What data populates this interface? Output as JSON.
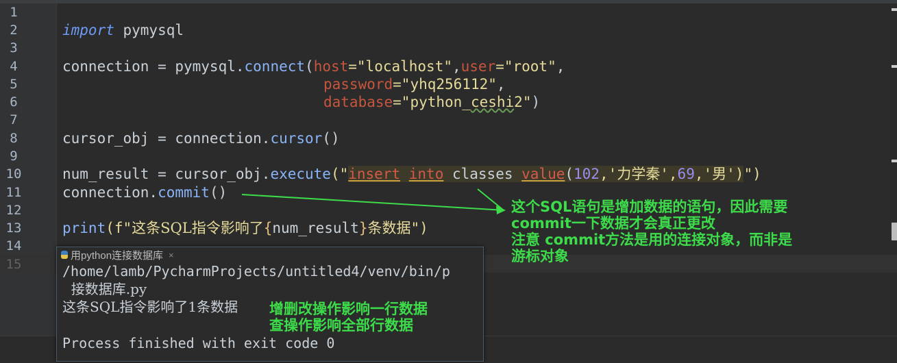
{
  "line_numbers": [
    "1",
    "2",
    "3",
    "4",
    "5",
    "6",
    "7",
    "8",
    "9",
    "10",
    "11",
    "12",
    "13",
    "14",
    "15"
  ],
  "code": {
    "l2_kw": "import",
    "l2_rest": " pymysql",
    "l4_a": "connection = pymysql.",
    "l4_fn": "connect",
    "l4_b": "(",
    "l4_p1": "host",
    "l4_s1": "=\"localhost\"",
    "l4_c": ",",
    "l4_p2": "user",
    "l4_s2": "=\"root\"",
    "l4_d": ",",
    "l5_p": "password",
    "l5_s": "=\"yhq256112\"",
    "l5_c": ",",
    "l6_p": "database",
    "l6_s1": "=\"python_",
    "l6_sq": "ceshi",
    "l6_s2": "2\"",
    "l6_e": ")",
    "l8_a": "cursor_obj = connection.",
    "l8_fn": "cursor",
    "l8_b": "()",
    "l10_a": "num_result = cursor_obj.",
    "l10_fn": "execute",
    "l10_b": "(\"",
    "l10_k1": "insert",
    "l10_sp1": " ",
    "l10_k2": "into",
    "l10_t": " classes ",
    "l10_k3": "value",
    "l10_p1": "(",
    "l10_n1": "102",
    "l10_p2": ",'",
    "l10_c1": "力学秦",
    "l10_p3": "',",
    "l10_n2": "69",
    "l10_p4": ",'",
    "l10_c2": "男",
    "l10_p5": "')",
    "l10_e": "\")",
    "l11_a": "connection.",
    "l11_fn": "commit",
    "l11_b": "()",
    "l13_fn": "print",
    "l13_a": "(f\"",
    "l13_c1": "这条SQL指令影响了",
    "l13_lb": "{",
    "l13_v": "num_result",
    "l13_rb": "}",
    "l13_c2": "条数据",
    "l13_e": "\")"
  },
  "run_popup": {
    "tab_label": "用python连接数据库",
    "close": "×",
    "line1": "/home/lamb/PycharmProjects/untitled4/venv/bin/p",
    "line2": "  接数据库.py",
    "line3": "这条SQL指令影响了1条数据",
    "line5": "Process finished with exit code 0"
  },
  "annotations": {
    "commit_note": "这个SQL语句是增加数据的语句，因此需要\ncommit一下数据才会真正更改\n注意 commit方法是用的连接对象，而非是\n游标对象",
    "affect_note": "增删改操作影响一行数据\n查操作影响全部行数据"
  },
  "colors": {
    "background": "#2b2b2b",
    "keyword": "#6e9bf5",
    "string": "#e6db9a",
    "param": "#c8553d",
    "annotation": "#3ddc4a"
  },
  "icons": [
    "python-file-icon",
    "close-icon",
    "arrow-icon"
  ]
}
